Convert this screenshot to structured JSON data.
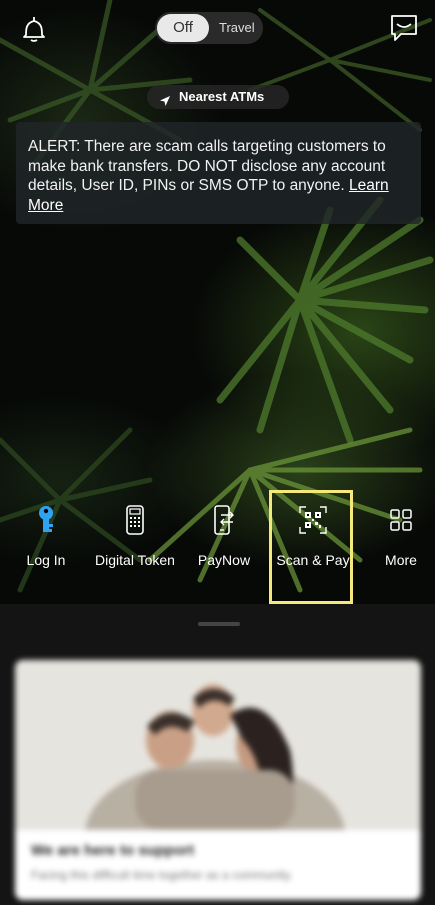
{
  "top": {
    "toggle_selected": "Off",
    "toggle_other": "Travel",
    "left_icon": "bell-icon",
    "right_icon": "message-icon"
  },
  "atm": {
    "label": "Nearest ATMs",
    "icon": "location-arrow-icon"
  },
  "alert": {
    "text": "ALERT: There are scam calls targeting customers to make bank transfers. DO NOT disclose any account details, User ID, PINs or SMS OTP to anyone. ",
    "link": "Learn More"
  },
  "actions": [
    {
      "label": "Log In",
      "icon": "key-icon"
    },
    {
      "label": "Digital Token",
      "icon": "token-icon"
    },
    {
      "label": "PayNow",
      "icon": "paynow-icon"
    },
    {
      "label": "Scan & Pay",
      "icon": "qr-scan-icon"
    },
    {
      "label": "More",
      "icon": "grid-icon"
    }
  ],
  "card": {
    "title": "We are here to support",
    "subtitle": "Facing this difficult time together as a community."
  },
  "colors": {
    "highlight": "#f5e97c",
    "key_icon": "#2ea3f2"
  }
}
